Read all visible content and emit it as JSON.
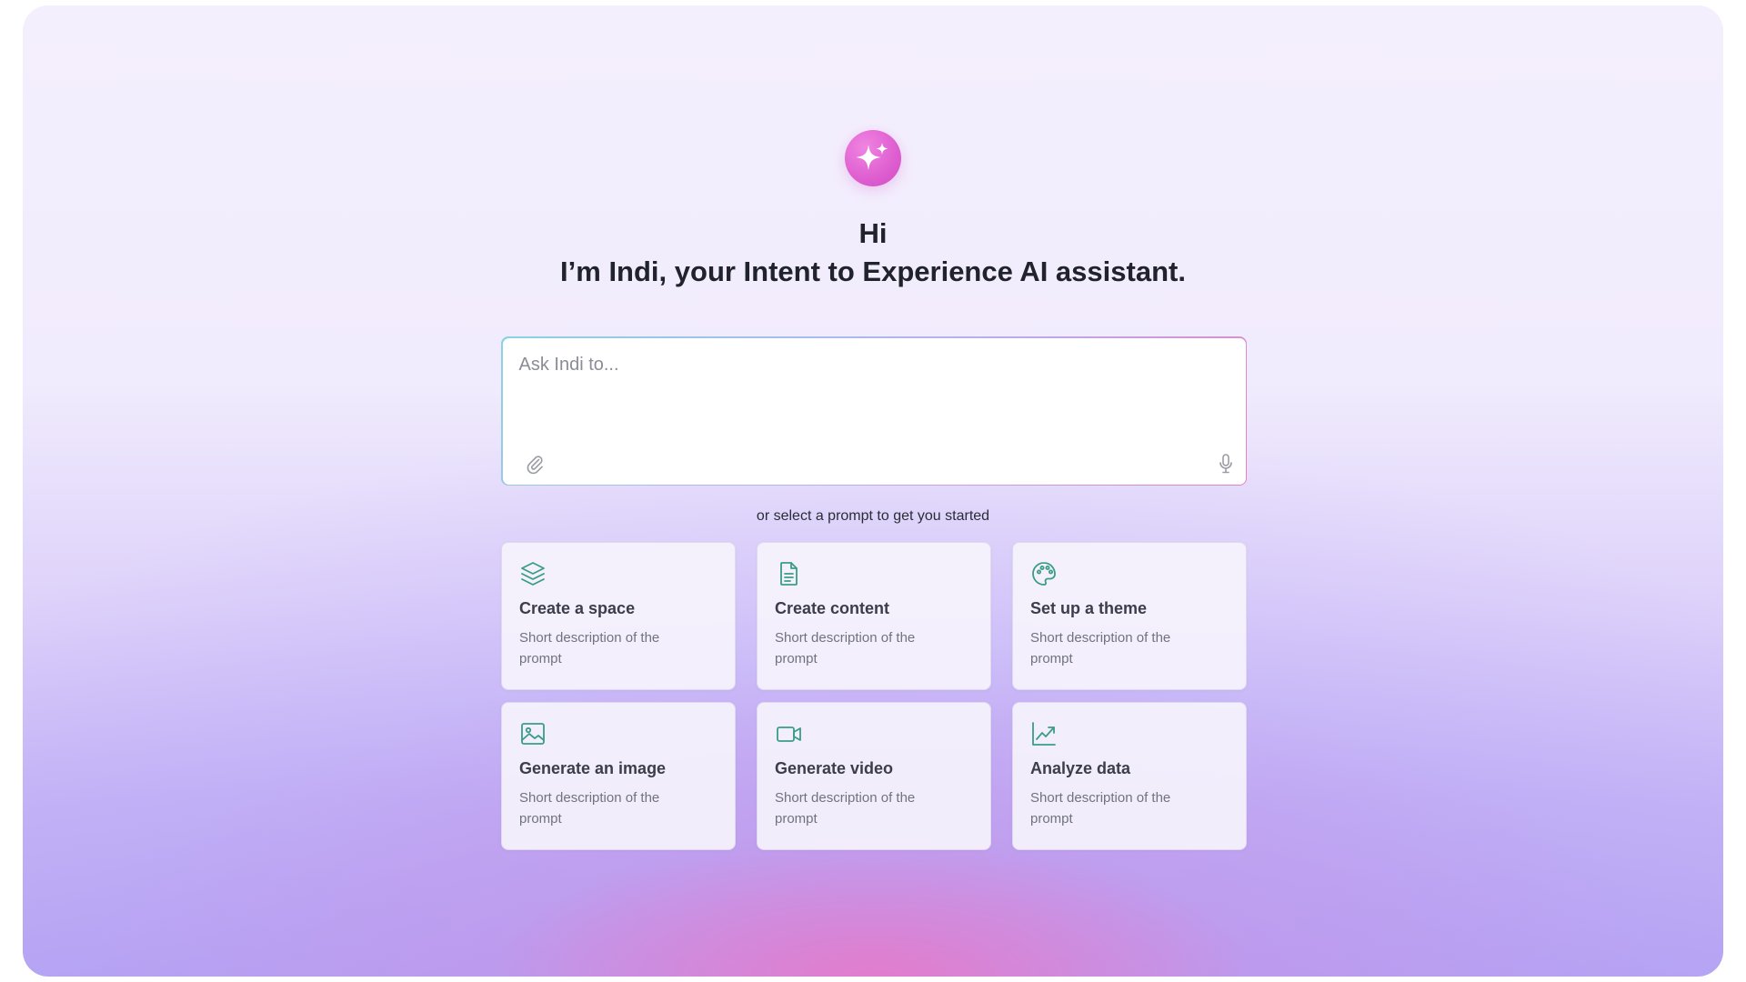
{
  "app": {
    "greeting_line1": "Hi",
    "greeting_line2": "I’m Indi, your Intent to Experience AI assistant."
  },
  "prompt": {
    "placeholder": "Ask Indi to...",
    "value": ""
  },
  "hint": "or select a prompt to get you started",
  "accent_icon_color": "#3a9d84",
  "cards": [
    {
      "title": "Create a space",
      "description": "Short description of the prompt",
      "icon": "layers-icon"
    },
    {
      "title": "Create content",
      "description": "Short description of the prompt",
      "icon": "document-icon"
    },
    {
      "title": "Set up a theme",
      "description": "Short description of the prompt",
      "icon": "palette-icon"
    },
    {
      "title": "Generate an image",
      "description": "Short description of the prompt",
      "icon": "image-icon"
    },
    {
      "title": "Generate video",
      "description": "Short description of the prompt",
      "icon": "video-icon"
    },
    {
      "title": "Analyze data",
      "description": "Short description of the prompt",
      "icon": "chart-line-icon"
    }
  ]
}
